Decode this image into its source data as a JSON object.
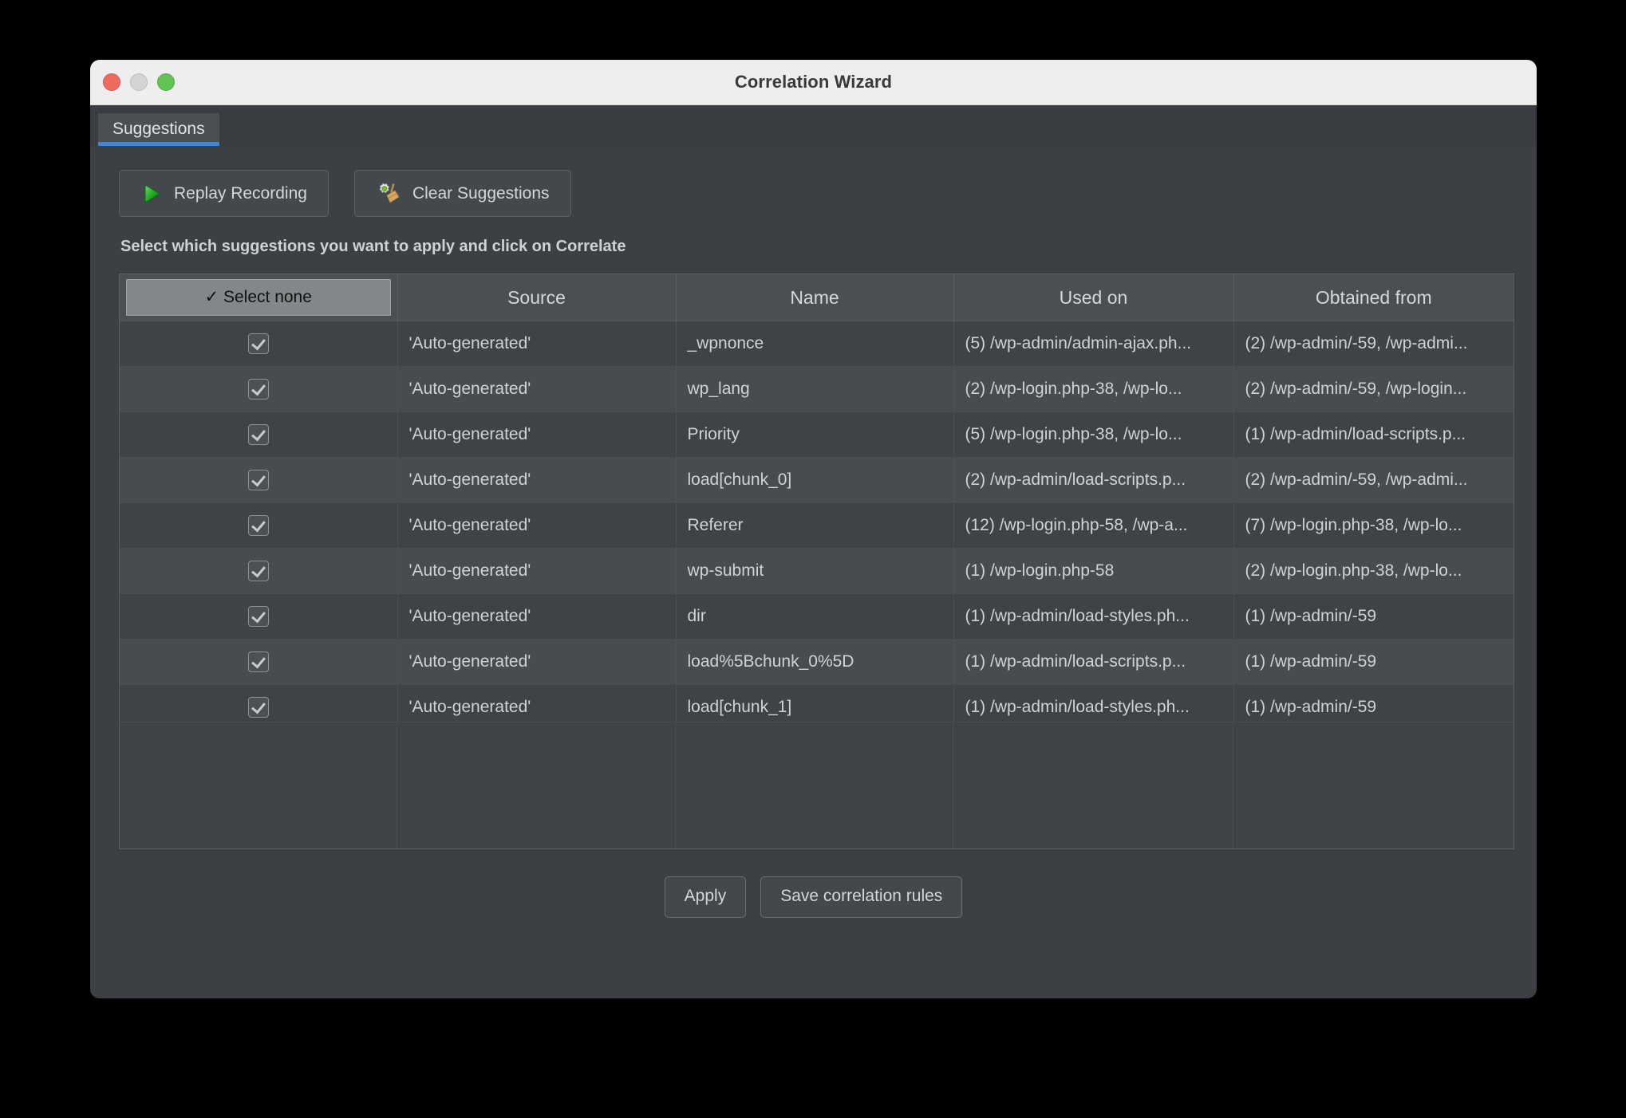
{
  "window": {
    "title": "Correlation Wizard",
    "controls": [
      "close-button",
      "minimize-button",
      "maximize-button"
    ]
  },
  "tabs": [
    {
      "label": "Suggestions",
      "active": true
    }
  ],
  "toolbar": {
    "replay_label": "Replay Recording",
    "replay_icon": "play-icon",
    "clear_label": "Clear Suggestions",
    "clear_icon": "broom-gear-icon"
  },
  "instruction": "Select which suggestions you want to apply and click on Correlate",
  "table": {
    "select_header": "✓ Select none",
    "columns": [
      "Source",
      "Name",
      "Used on",
      "Obtained from"
    ],
    "rows": [
      {
        "checked": true,
        "source": "'Auto-generated'",
        "name": "_wpnonce",
        "used_on": "(5) /wp-admin/admin-ajax.ph...",
        "obtained_from": "(2) /wp-admin/-59, /wp-admi..."
      },
      {
        "checked": true,
        "source": "'Auto-generated'",
        "name": "wp_lang",
        "used_on": "(2) /wp-login.php-38, /wp-lo...",
        "obtained_from": "(2) /wp-admin/-59, /wp-login..."
      },
      {
        "checked": true,
        "source": "'Auto-generated'",
        "name": "Priority",
        "used_on": "(5) /wp-login.php-38, /wp-lo...",
        "obtained_from": "(1) /wp-admin/load-scripts.p..."
      },
      {
        "checked": true,
        "source": "'Auto-generated'",
        "name": "load[chunk_0]",
        "used_on": "(2) /wp-admin/load-scripts.p...",
        "obtained_from": "(2) /wp-admin/-59, /wp-admi..."
      },
      {
        "checked": true,
        "source": "'Auto-generated'",
        "name": "Referer",
        "used_on": "(12) /wp-login.php-58, /wp-a...",
        "obtained_from": "(7) /wp-login.php-38, /wp-lo..."
      },
      {
        "checked": true,
        "source": "'Auto-generated'",
        "name": "wp-submit",
        "used_on": "(1) /wp-login.php-58",
        "obtained_from": "(2) /wp-login.php-38, /wp-lo..."
      },
      {
        "checked": true,
        "source": "'Auto-generated'",
        "name": "dir",
        "used_on": "(1) /wp-admin/load-styles.ph...",
        "obtained_from": "(1) /wp-admin/-59"
      },
      {
        "checked": true,
        "source": "'Auto-generated'",
        "name": "load%5Bchunk_0%5D",
        "used_on": "(1) /wp-admin/load-scripts.p...",
        "obtained_from": "(1) /wp-admin/-59"
      },
      {
        "checked": true,
        "source": "'Auto-generated'",
        "name": "load[chunk_1]",
        "used_on": "(1) /wp-admin/load-styles.ph...",
        "obtained_from": "(1) /wp-admin/-59"
      }
    ]
  },
  "footer": {
    "apply_label": "Apply",
    "save_label": "Save correlation rules"
  },
  "colors": {
    "accent": "#3d87d8",
    "titlebar": "#eeeeee",
    "panel": "#3c4044",
    "row_odd": "#3e4347",
    "row_even": "#474c50",
    "header": "#4a4f53",
    "close": "#ee6a5f",
    "minimize": "#d4d4d4",
    "maximize": "#61c555"
  }
}
